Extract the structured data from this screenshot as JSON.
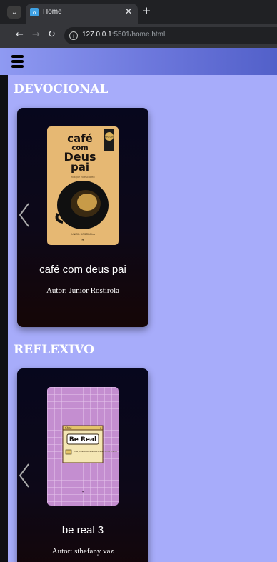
{
  "browser": {
    "tab_title": "Home",
    "url_host": "127.0.0.1",
    "url_rest": ":5501/home.html"
  },
  "sections": [
    {
      "title": "DEVOCIONAL",
      "book": {
        "title": "café com deus pai",
        "author": "Autor: Junior Rostirola",
        "cover": {
          "line1": "café",
          "line2": "com",
          "line3": "Deus",
          "line4": "pai",
          "badge": "450.000",
          "subtitle": "PORQUE EU ESCOLHO",
          "cover_author": "JUNIOR ROSTIROLA"
        }
      }
    },
    {
      "title": "REFLEXIVO",
      "book": {
        "title": "be real 3",
        "author": "Autor: sthefany vaz",
        "cover": {
          "window_title": "Chat",
          "headline": "Be Real",
          "body": "Uma jornada de reflexões e autoconhecimento"
        }
      }
    }
  ],
  "colors": {
    "page_bg": "#a7acfa",
    "header_start": "#8f9af2",
    "header_end": "#5260c9",
    "card_top": "#07071d",
    "card_bottom": "#150606"
  }
}
